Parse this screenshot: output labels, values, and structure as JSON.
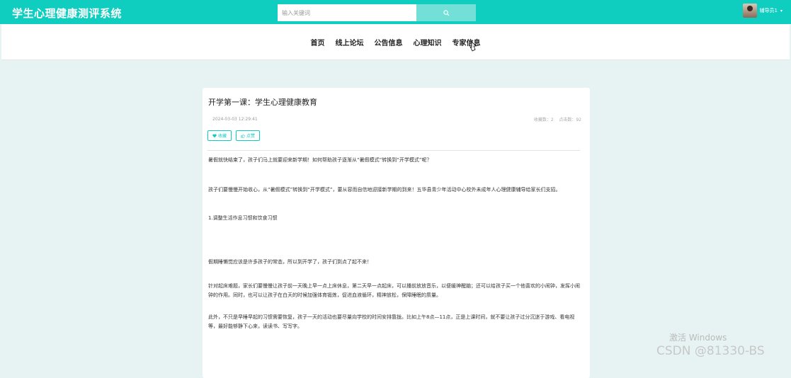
{
  "header": {
    "title": "学生心理健康测评系统",
    "search_placeholder": "输入关键词",
    "search_icon": "search-icon",
    "username": "辅导员1",
    "user_caret": "▾"
  },
  "nav": {
    "items": [
      "首页",
      "线上论坛",
      "公告信息",
      "心理知识",
      "专家信息"
    ]
  },
  "article": {
    "title": "开学第一课：学生心理健康教育",
    "date": "2024-03-03 12:29:41",
    "favorites": "收藏数：2",
    "clicks": "点击数：92",
    "favorite_label": "收藏",
    "like_label": "点赞",
    "paragraphs": [
      "暑假就快结束了，孩子们马上就要迎来新学期！如何帮助孩子逐渐从“暑假模式”转换到“开学模式”呢？",
      "孩子们要慢慢开始收心，从“暑假模式”转换到“开学模式”，要从容而自信地迎接新学期的到来！五华县青少年活动中心校外未成年人心理健康辅导给家长们支招。",
      "1.调整生活作息习惯和饮食习惯",
      "假期睡懒觉应该是许多孩子的常态，所以到开学了，孩子们到点了起不来！",
      "针对起床难题，家长们要慢慢让孩子前一天晚上早一点上床休息，第二天早一点起床，可以播前放放音乐，以便缓神醒脑；还可以给孩子买一个他喜欢的小闹钟，发挥小闹钟的作用。同时，也可以让孩子在白天的时候加强体育锻炼，促进血液循环，精神放松，保障睡眠的质量。",
      "此外，不只是早睡早起的习惯需要恢复，孩子一天的活动也要尽量向学校的时间安排靠拢。比如上午8点—11点，正是上课时间，就不要让孩子过分沉迷于游戏、看电视等，最好能够静下心来，读读书、写写字。"
    ]
  },
  "watermark": {
    "windows": "激活 Windows",
    "csdn": "CSDN @81330-BS"
  },
  "colors": {
    "accent": "#0fcdbf",
    "page_bg": "#e6f3f2"
  }
}
